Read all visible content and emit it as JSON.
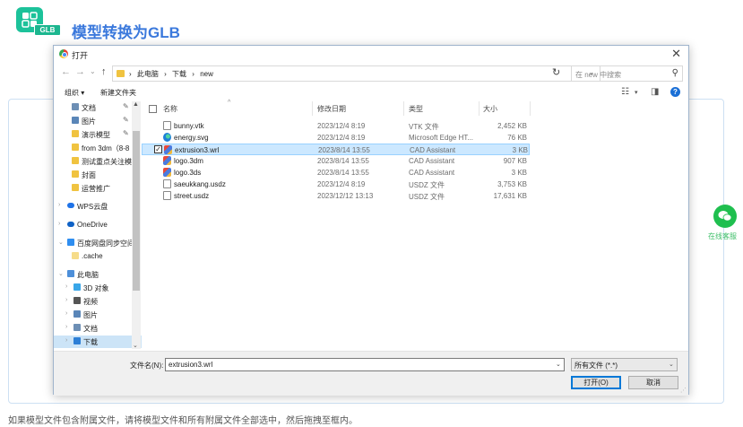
{
  "header": {
    "logo_badge": "GLB",
    "title": "模型转换为GLB"
  },
  "page_hint": "如果模型文件包含附属文件，请将模型文件和所有附属文件全部选中，然后拖拽至框内。",
  "widget": {
    "label": "在线客服"
  },
  "dialog": {
    "title": "打开",
    "nav": {
      "back": "←",
      "forward": "→",
      "recent": "⌄",
      "up": "↑"
    },
    "breadcrumbs": [
      "›",
      "此电脑",
      "›",
      "下载",
      "›",
      "new"
    ],
    "search_placeholder": "在 new 中搜索",
    "toolbar": {
      "organize": "组织 ▾",
      "new_folder": "新建文件夹"
    },
    "nav_pane": [
      {
        "label": "文档",
        "pinned": true
      },
      {
        "label": "图片",
        "pinned": true
      },
      {
        "label": "演示模型",
        "pinned": true
      },
      {
        "label": "from 3dm（8-8",
        "pinned": false
      },
      {
        "label": "测试重点关注模",
        "pinned": false
      },
      {
        "label": "封面",
        "pinned": false
      },
      {
        "label": "运营推广",
        "pinned": false
      },
      {
        "label": "WPS云盘",
        "pinned": false
      },
      {
        "label": "OneDrive",
        "pinned": false
      },
      {
        "label": "百度网盘同步空间",
        "pinned": false
      },
      {
        "label": ".cache",
        "pinned": false
      },
      {
        "label": "此电脑",
        "pinned": false
      },
      {
        "label": "3D 对象",
        "pinned": false
      },
      {
        "label": "视频",
        "pinned": false
      },
      {
        "label": "图片",
        "pinned": false
      },
      {
        "label": "文档",
        "pinned": false
      },
      {
        "label": "下载",
        "pinned": false
      }
    ],
    "columns": {
      "name": "名称",
      "date": "修改日期",
      "type": "类型",
      "size": "大小"
    },
    "files": [
      {
        "name": "bunny.vtk",
        "date": "2023/12/4 8:19",
        "type": "VTK 文件",
        "size": "2,452 KB",
        "icon": "document-icon",
        "selected": false
      },
      {
        "name": "energy.svg",
        "date": "2023/12/4 8:19",
        "type": "Microsoft Edge HT...",
        "size": "76 KB",
        "icon": "edge-icon",
        "selected": false
      },
      {
        "name": "extrusion3.wrl",
        "date": "2023/8/14 13:55",
        "type": "CAD Assistant",
        "size": "3 KB",
        "icon": "cad-icon",
        "selected": true
      },
      {
        "name": "logo.3dm",
        "date": "2023/8/14 13:55",
        "type": "CAD Assistant",
        "size": "907 KB",
        "icon": "cad-icon",
        "selected": false
      },
      {
        "name": "logo.3ds",
        "date": "2023/8/14 13:55",
        "type": "CAD Assistant",
        "size": "3 KB",
        "icon": "cad-icon",
        "selected": false
      },
      {
        "name": "saeukkang.usdz",
        "date": "2023/12/4 8:19",
        "type": "USDZ 文件",
        "size": "3,753 KB",
        "icon": "document-icon",
        "selected": false
      },
      {
        "name": "street.usdz",
        "date": "2023/12/12 13:13",
        "type": "USDZ 文件",
        "size": "17,631 KB",
        "icon": "document-icon",
        "selected": false
      }
    ],
    "filename_label": "文件名(N):",
    "filename_value": "extrusion3.wrl",
    "filetype_value": "所有文件 (*.*)",
    "open_button": "打开(O)",
    "cancel_button": "取消"
  },
  "colors": {
    "accent": "#3b79dc",
    "brand": "#1cc29a",
    "selection": "#cce8ff"
  }
}
